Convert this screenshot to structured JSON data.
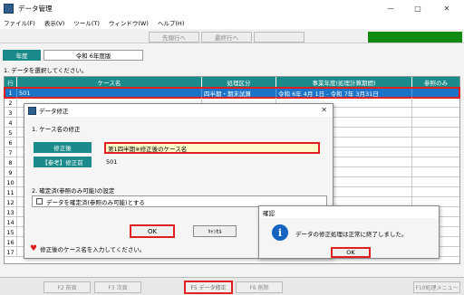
{
  "window": {
    "title": "データ管理",
    "minimize": "—",
    "maximize": "□",
    "close": "✕"
  },
  "menu": [
    "ファイル(F)",
    "表示(V)",
    "ツール(T)",
    "ウィンドウ(W)",
    "ヘルプ(H)"
  ],
  "toolbar": {
    "prev": "先頭行へ",
    "last": "最終行へ"
  },
  "year": {
    "label": "年度",
    "value": "令和 6年度版"
  },
  "instruction": "1. データを選択してください。",
  "grid": {
    "headers": [
      "行",
      "ケース名",
      "処理区分",
      "事業年度(処理計算期間)",
      "参照のみ"
    ],
    "rows": [
      {
        "no": "1",
        "name": "501",
        "type": "四半期・期末試算",
        "period": "令和 6年 4月 1日 - 令和 7年 3月31日",
        "ref": ""
      },
      {
        "no": "2"
      },
      {
        "no": "3"
      },
      {
        "no": "4"
      },
      {
        "no": "5"
      },
      {
        "no": "6"
      },
      {
        "no": "7"
      },
      {
        "no": "8"
      },
      {
        "no": "9"
      },
      {
        "no": "10"
      },
      {
        "no": "11"
      },
      {
        "no": "12"
      },
      {
        "no": "13"
      },
      {
        "no": "14"
      },
      {
        "no": "15"
      },
      {
        "no": "16"
      },
      {
        "no": "17"
      }
    ]
  },
  "fkeys": [
    "F2 前頁",
    "F3 次頁",
    "F5 データ修正",
    "F6 削除",
    "F10処理メニュー"
  ],
  "dialog_edit": {
    "title": "データ修正",
    "close": "✕",
    "section1": "1. ケース名の修正",
    "new_label": "修正後",
    "new_value": "第1四半期※修正後のケース名",
    "old_label": "【参考】修正前",
    "old_value": "501",
    "section2": "2. 確定済(参照のみ可能)の設定",
    "checkbox_label": "データを確定済(参照のみ可能)とする",
    "checkbox_checked": false,
    "ok": "OK",
    "cancel": "ｷｬﾝｾﾙ",
    "hint_icon": "heart-icon",
    "hint": "修正後のケース名を入力してください。"
  },
  "dialog_confirm": {
    "title": "確認",
    "icon": "info-icon",
    "message": "データの修正処理は正常に終了しました。",
    "ok": "OK"
  },
  "colors": {
    "teal": "#1a8a8a",
    "selection": "#1c74c8",
    "highlight": "#e02020",
    "green": "#118a11"
  }
}
